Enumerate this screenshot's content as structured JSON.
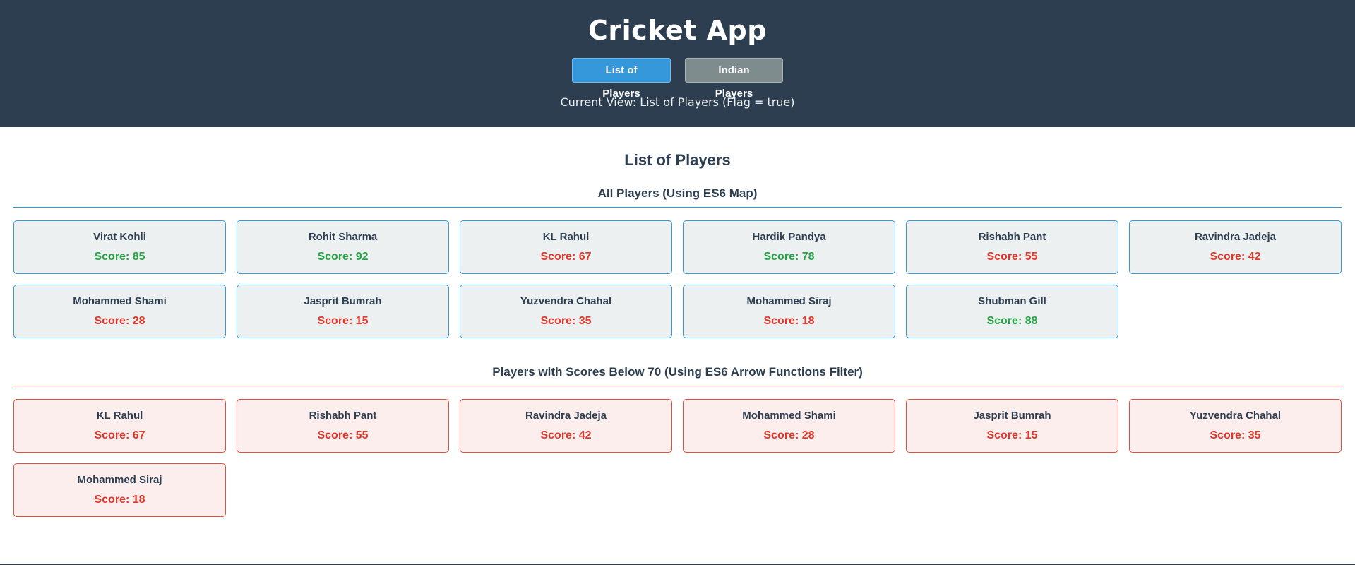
{
  "header": {
    "title": "Cricket App",
    "buttons": {
      "list": "List of Players",
      "indian": "Indian Players"
    },
    "current_view": "Current View: List of Players (Flag = true)"
  },
  "main": {
    "title": "List of Players",
    "all_section": {
      "heading": "All Players (Using ES6 Map)",
      "players": [
        {
          "name": "Virat Kohli",
          "score": "Score: 85",
          "level": "high"
        },
        {
          "name": "Rohit Sharma",
          "score": "Score: 92",
          "level": "high"
        },
        {
          "name": "KL Rahul",
          "score": "Score: 67",
          "level": "low"
        },
        {
          "name": "Hardik Pandya",
          "score": "Score: 78",
          "level": "high"
        },
        {
          "name": "Rishabh Pant",
          "score": "Score: 55",
          "level": "low"
        },
        {
          "name": "Ravindra Jadeja",
          "score": "Score: 42",
          "level": "low"
        },
        {
          "name": "Mohammed Shami",
          "score": "Score: 28",
          "level": "low"
        },
        {
          "name": "Jasprit Bumrah",
          "score": "Score: 15",
          "level": "low"
        },
        {
          "name": "Yuzvendra Chahal",
          "score": "Score: 35",
          "level": "low"
        },
        {
          "name": "Mohammed Siraj",
          "score": "Score: 18",
          "level": "low"
        },
        {
          "name": "Shubman Gill",
          "score": "Score: 88",
          "level": "high"
        }
      ]
    },
    "below_section": {
      "heading": "Players with Scores Below 70 (Using ES6 Arrow Functions Filter)",
      "players": [
        {
          "name": "KL Rahul",
          "score": "Score: 67"
        },
        {
          "name": "Rishabh Pant",
          "score": "Score: 55"
        },
        {
          "name": "Ravindra Jadeja",
          "score": "Score: 42"
        },
        {
          "name": "Mohammed Shami",
          "score": "Score: 28"
        },
        {
          "name": "Jasprit Bumrah",
          "score": "Score: 15"
        },
        {
          "name": "Yuzvendra Chahal",
          "score": "Score: 35"
        },
        {
          "name": "Mohammed Siraj",
          "score": "Score: 18"
        }
      ]
    }
  },
  "colors": {
    "header_bg": "#2c3e50",
    "active_button": "#3498db",
    "inactive_button": "#7f8c8d",
    "score_high": "#27a245",
    "score_low": "#e0392b"
  }
}
